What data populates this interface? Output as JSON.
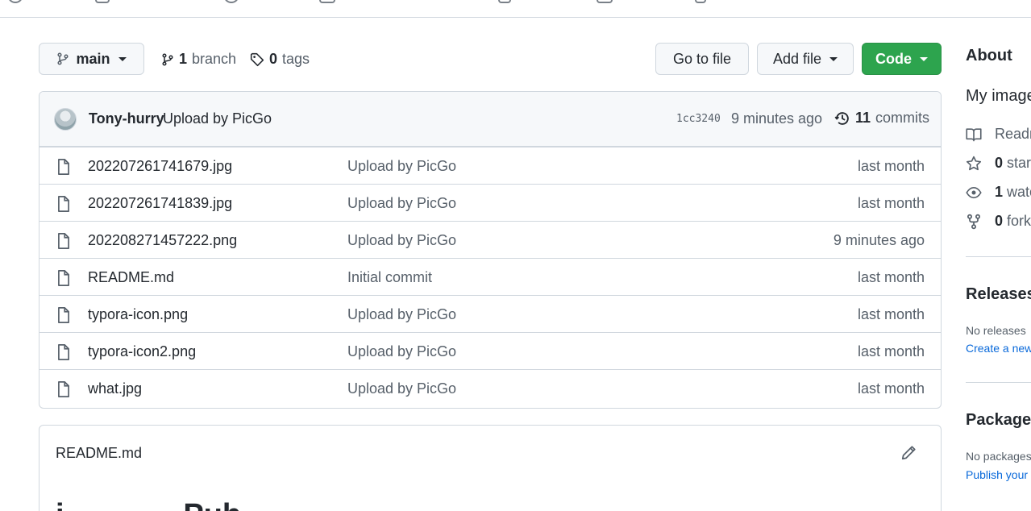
{
  "colors": {
    "accent_green": "#2da44e",
    "link_blue": "#0969da",
    "muted": "#57606a",
    "border": "#d0d7de"
  },
  "branch": {
    "name": "main",
    "branch_count": "1",
    "branch_label": "branch",
    "tag_count": "0",
    "tag_label": "tags"
  },
  "actions": {
    "go_to_file": "Go to file",
    "add_file": "Add file",
    "code": "Code"
  },
  "commit": {
    "author": "Tony-hurry",
    "message": "Upload by PicGo",
    "hash": "1cc3240",
    "time": "9 minutes ago",
    "count": "11",
    "count_label": "commits"
  },
  "files": [
    {
      "name": "202207261741679.jpg",
      "message": "Upload by PicGo",
      "time": "last month",
      "icon": "file-icon"
    },
    {
      "name": "202207261741839.jpg",
      "message": "Upload by PicGo",
      "time": "last month",
      "icon": "file-icon"
    },
    {
      "name": "202208271457222.png",
      "message": "Upload by PicGo",
      "time": "9 minutes ago",
      "icon": "file-icon"
    },
    {
      "name": "README.md",
      "message": "Initial commit",
      "time": "last month",
      "icon": "file-icon"
    },
    {
      "name": "typora-icon.png",
      "message": "Upload by PicGo",
      "time": "last month",
      "icon": "file-icon"
    },
    {
      "name": "typora-icon2.png",
      "message": "Upload by PicGo",
      "time": "last month",
      "icon": "file-icon"
    },
    {
      "name": "what.jpg",
      "message": "Upload by PicGo",
      "time": "last month",
      "icon": "file-icon"
    }
  ],
  "readme": {
    "title": "README.md",
    "heading_fragment": "i              Pub"
  },
  "sidebar": {
    "about_title": "About",
    "description": "My image",
    "readme_label": "Readm",
    "stars_count": "0",
    "stars_label": "stars",
    "watch_count": "1",
    "watch_label": "watc",
    "forks_count": "0",
    "forks_label": "forks",
    "releases_title": "Releases",
    "releases_empty": "No releases",
    "releases_link": "Create a new",
    "packages_title": "Packages",
    "packages_empty": "No packages",
    "packages_link": "Publish your"
  }
}
